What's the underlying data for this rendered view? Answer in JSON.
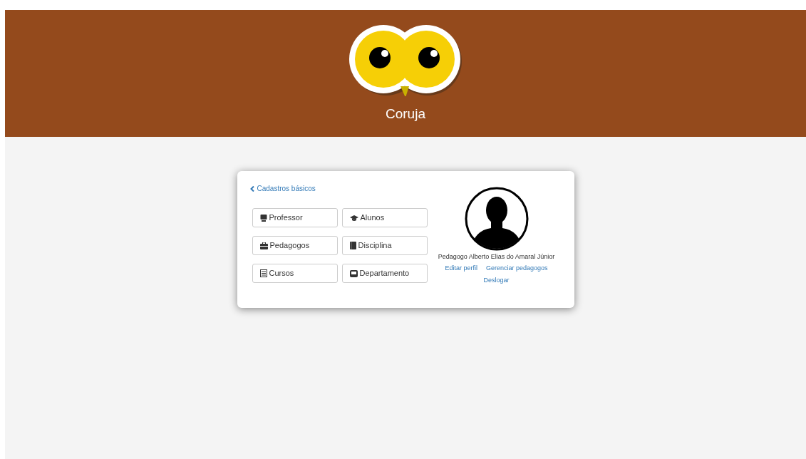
{
  "header": {
    "title": "Coruja"
  },
  "card": {
    "back_link": "Cadastros básicos",
    "buttons": [
      {
        "label": "Professor",
        "kind": "monitor"
      },
      {
        "label": "Alunos",
        "kind": "cap"
      },
      {
        "label": "Pedagogos",
        "kind": "briefcase"
      },
      {
        "label": "Disciplina",
        "kind": "book"
      },
      {
        "label": "Cursos",
        "kind": "list"
      },
      {
        "label": "Departamento",
        "kind": "inbox"
      }
    ],
    "profile": {
      "name": "Pedagogo Alberto Elias do Amaral Júnior",
      "links": [
        "Editar perfil",
        "Gerenciar pedagogos",
        "Deslogar"
      ]
    }
  }
}
